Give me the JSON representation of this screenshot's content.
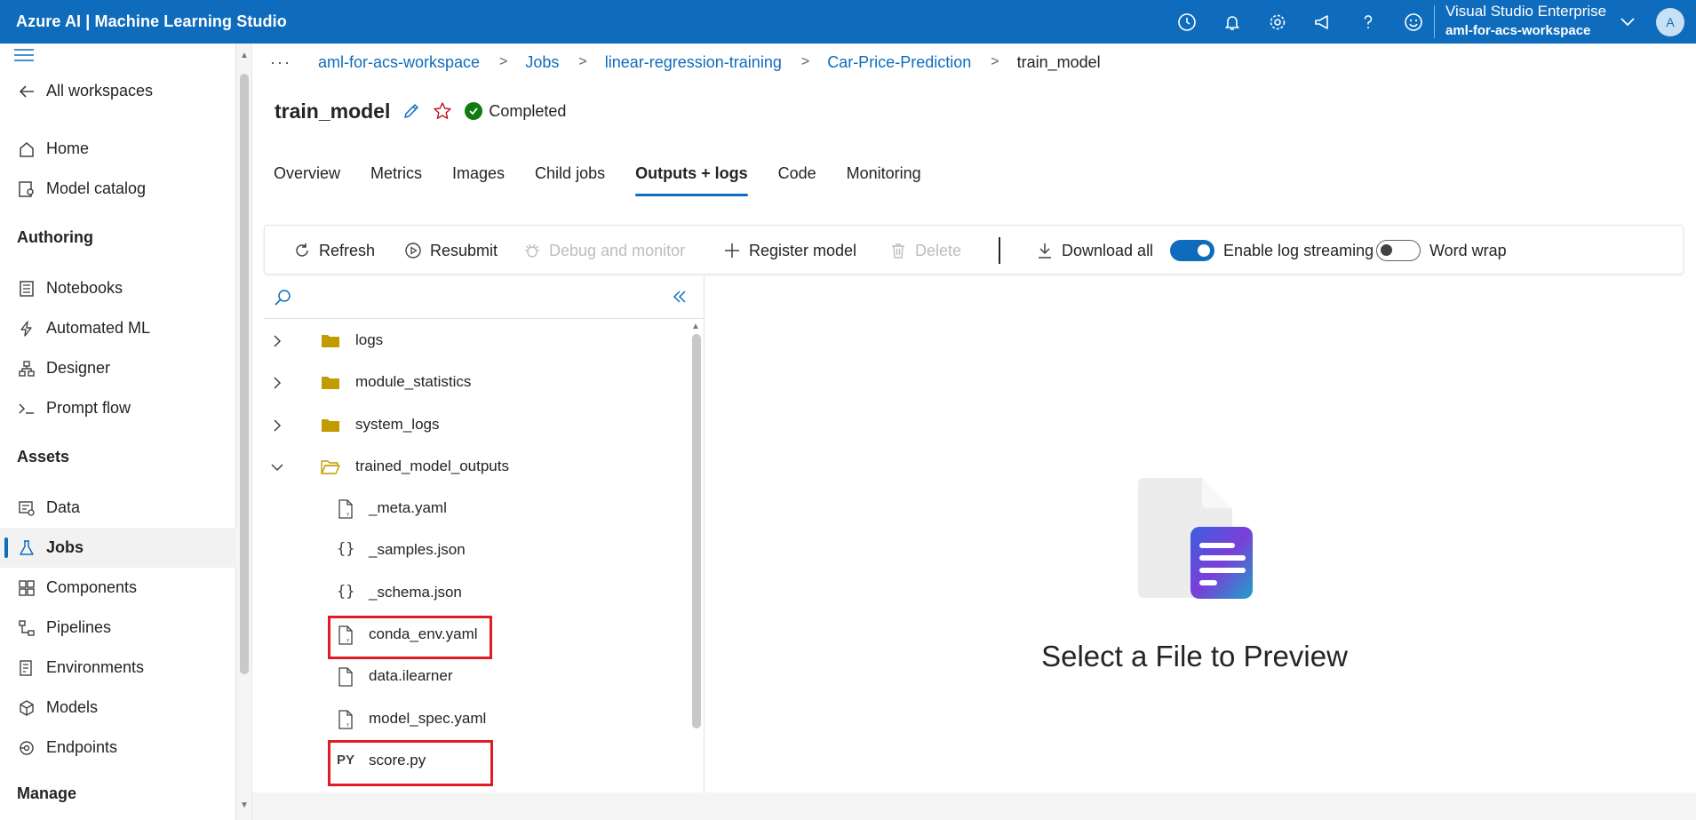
{
  "app": {
    "title": "Azure AI | Machine Learning Studio"
  },
  "topbar": {
    "icons": [
      "history-icon",
      "bell-icon",
      "gear-icon",
      "megaphone-icon",
      "help-icon",
      "smiley-icon"
    ],
    "account_subscription": "Visual Studio Enterprise",
    "account_workspace": "aml-for-acs-workspace",
    "avatar_initial": "A"
  },
  "sidebar": {
    "all_workspaces": "All workspaces",
    "items_top": [
      {
        "label": "Home",
        "icon": "home-icon"
      },
      {
        "label": "Model catalog",
        "icon": "catalog-icon"
      }
    ],
    "authoring_header": "Authoring",
    "authoring_items": [
      {
        "label": "Notebooks",
        "icon": "notebook-icon"
      },
      {
        "label": "Automated ML",
        "icon": "automl-icon"
      },
      {
        "label": "Designer",
        "icon": "designer-icon"
      },
      {
        "label": "Prompt flow",
        "icon": "prompt-flow-icon"
      }
    ],
    "assets_header": "Assets",
    "assets_items": [
      {
        "label": "Data",
        "icon": "data-icon"
      },
      {
        "label": "Jobs",
        "icon": "flask-icon",
        "active": true
      },
      {
        "label": "Components",
        "icon": "components-icon"
      },
      {
        "label": "Pipelines",
        "icon": "pipelines-icon"
      },
      {
        "label": "Environments",
        "icon": "environments-icon"
      },
      {
        "label": "Models",
        "icon": "cube-icon"
      },
      {
        "label": "Endpoints",
        "icon": "endpoints-icon"
      }
    ],
    "manage_header": "Manage"
  },
  "breadcrumb": {
    "more": "···",
    "items": [
      "aml-for-acs-workspace",
      "Jobs",
      "linear-regression-training",
      "Car-Price-Prediction",
      "train_model"
    ]
  },
  "job": {
    "title": "train_model",
    "status": "Completed"
  },
  "tabs": [
    "Overview",
    "Metrics",
    "Images",
    "Child jobs",
    "Outputs + logs",
    "Code",
    "Monitoring"
  ],
  "active_tab": "Outputs + logs",
  "toolbar": {
    "refresh": "Refresh",
    "resubmit": "Resubmit",
    "debug": "Debug and monitor",
    "register": "Register model",
    "delete": "Delete",
    "download_all": "Download all",
    "log_streaming": "Enable log streaming",
    "log_streaming_on": true,
    "word_wrap": "Word wrap",
    "word_wrap_on": false
  },
  "tree": {
    "folders": [
      {
        "name": "logs",
        "expanded": false
      },
      {
        "name": "module_statistics",
        "expanded": false
      },
      {
        "name": "system_logs",
        "expanded": false
      },
      {
        "name": "trained_model_outputs",
        "expanded": true
      }
    ],
    "files": [
      {
        "name": "_meta.yaml",
        "icon": "yaml-file-icon"
      },
      {
        "name": "_samples.json",
        "icon": "json-file-icon"
      },
      {
        "name": "_schema.json",
        "icon": "json-file-icon"
      },
      {
        "name": "conda_env.yaml",
        "icon": "yaml-file-icon",
        "highlighted": true
      },
      {
        "name": "data.ilearner",
        "icon": "file-icon"
      },
      {
        "name": "model_spec.yaml",
        "icon": "yaml-file-icon"
      },
      {
        "name": "score.py",
        "icon": "python-file-icon",
        "label": "PY",
        "highlighted": true
      }
    ]
  },
  "preview": {
    "message": "Select a File to Preview"
  },
  "colors": {
    "brand": "#0f6cbd",
    "highlight": "#e01b24",
    "folder": "#c19c00",
    "success": "#107c10"
  }
}
